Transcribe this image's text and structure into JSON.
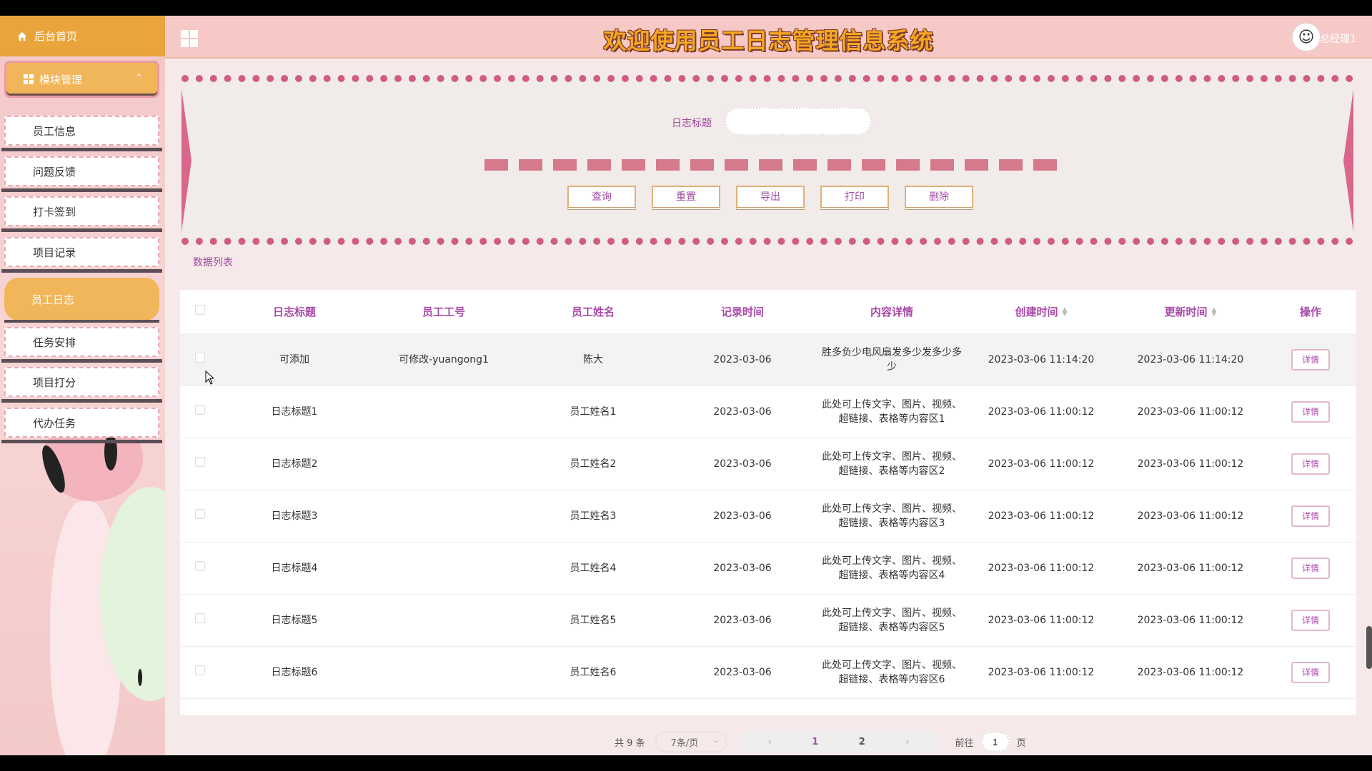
{
  "sidebar": {
    "home_label": "后台首页",
    "module_label": "模块管理",
    "items": [
      {
        "label": "员工信息"
      },
      {
        "label": "问题反馈"
      },
      {
        "label": "打卡签到"
      },
      {
        "label": "项目记录"
      },
      {
        "label": "员工日志",
        "active": true
      },
      {
        "label": "任务安排"
      },
      {
        "label": "项目打分"
      },
      {
        "label": "代办任务"
      }
    ]
  },
  "header": {
    "title": "欢迎使用员工日志管理信息系统",
    "user": "总经理1",
    "apps_icon": "grid-icon"
  },
  "search": {
    "label": "日志标题",
    "value": "",
    "buttons": [
      "查询",
      "重置",
      "导出",
      "打印",
      "删除"
    ]
  },
  "list_label": "数据列表",
  "table": {
    "columns": [
      "日志标题",
      "员工工号",
      "员工姓名",
      "记录时间",
      "内容详情",
      "创建时间",
      "更新时间",
      "操作"
    ],
    "rows": [
      {
        "title": "可添加",
        "emp_no": "可修改-yuangong1",
        "emp_name": "陈大",
        "record_time": "2023-03-06",
        "content": "胜多负少电风扇发多少发多少多少",
        "created": "2023-03-06 11:14:20",
        "updated": "2023-03-06 11:14:20",
        "action": "详情"
      },
      {
        "title": "日志标题1",
        "emp_no": "",
        "emp_name": "员工姓名1",
        "record_time": "2023-03-06",
        "content": "此处可上传文字、图片、视频、超链接、表格等内容区1",
        "created": "2023-03-06 11:00:12",
        "updated": "2023-03-06 11:00:12",
        "action": "详情"
      },
      {
        "title": "日志标题2",
        "emp_no": "",
        "emp_name": "员工姓名2",
        "record_time": "2023-03-06",
        "content": "此处可上传文字、图片、视频、超链接、表格等内容区2",
        "created": "2023-03-06 11:00:12",
        "updated": "2023-03-06 11:00:12",
        "action": "详情"
      },
      {
        "title": "日志标题3",
        "emp_no": "",
        "emp_name": "员工姓名3",
        "record_time": "2023-03-06",
        "content": "此处可上传文字、图片、视频、超链接、表格等内容区3",
        "created": "2023-03-06 11:00:12",
        "updated": "2023-03-06 11:00:12",
        "action": "详情"
      },
      {
        "title": "日志标题4",
        "emp_no": "",
        "emp_name": "员工姓名4",
        "record_time": "2023-03-06",
        "content": "此处可上传文字、图片、视频、超链接、表格等内容区4",
        "created": "2023-03-06 11:00:12",
        "updated": "2023-03-06 11:00:12",
        "action": "详情"
      },
      {
        "title": "日志标题5",
        "emp_no": "",
        "emp_name": "员工姓名5",
        "record_time": "2023-03-06",
        "content": "此处可上传文字、图片、视频、超链接、表格等内容区5",
        "created": "2023-03-06 11:00:12",
        "updated": "2023-03-06 11:00:12",
        "action": "详情"
      },
      {
        "title": "日志标题6",
        "emp_no": "",
        "emp_name": "员工姓名6",
        "record_time": "2023-03-06",
        "content": "此处可上传文字、图片、视频、超链接、表格等内容区6",
        "created": "2023-03-06 11:00:12",
        "updated": "2023-03-06 11:00:12",
        "action": "详情"
      }
    ]
  },
  "pagination": {
    "total": "共 9 条",
    "page_size": "7条/页",
    "pages": [
      "1",
      "2"
    ],
    "goto_prefix": "前往",
    "goto_value": "1",
    "goto_suffix": "页"
  }
}
